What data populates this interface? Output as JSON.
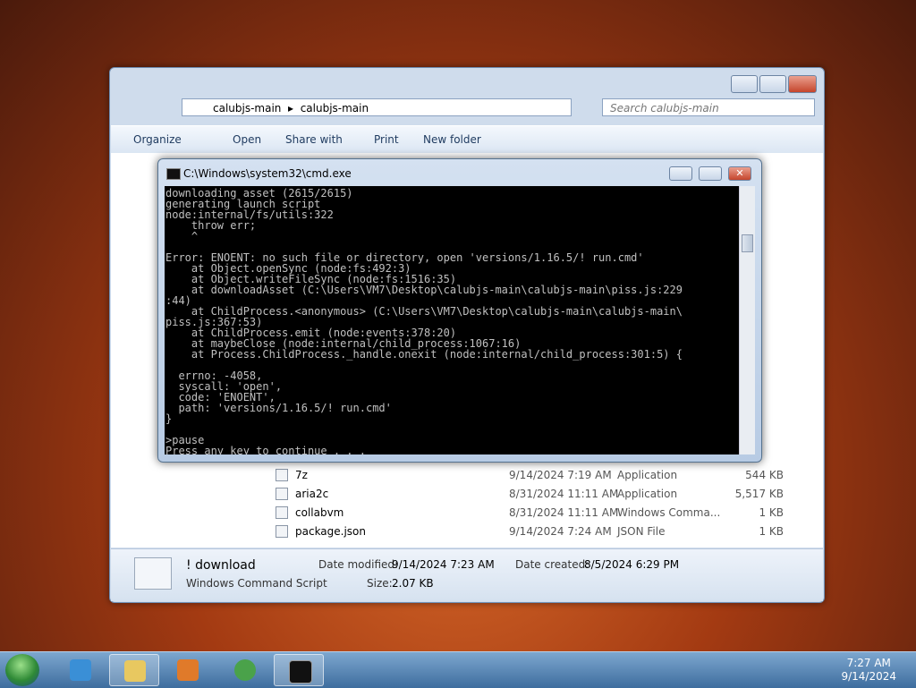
{
  "explorer": {
    "breadcrumb": [
      "calubjs-main",
      "calubjs-main"
    ],
    "search_placeholder": "Search calubjs-main",
    "toolbar": [
      "Organize",
      "Open",
      "Share with",
      "Print",
      "New folder"
    ],
    "files": [
      {
        "name": "7z",
        "date": "9/14/2024 7:19 AM",
        "type": "Application",
        "size": "544 KB"
      },
      {
        "name": "aria2c",
        "date": "8/31/2024 11:11 AM",
        "type": "Application",
        "size": "5,517 KB"
      },
      {
        "name": "collabvm",
        "date": "8/31/2024 11:11 AM",
        "type": "Windows Comma...",
        "size": "1 KB"
      },
      {
        "name": "package.json",
        "date": "9/14/2024 7:24 AM",
        "type": "JSON File",
        "size": "1 KB"
      }
    ],
    "details": {
      "name": "! download",
      "type": "Windows Command Script",
      "modified_label": "Date modified:",
      "modified": "9/14/2024 7:23 AM",
      "created_label": "Date created:",
      "created": "8/5/2024 6:29 PM",
      "size_label": "Size:",
      "size": "2.07 KB"
    }
  },
  "cmd": {
    "title": "C:\\Windows\\system32\\cmd.exe",
    "output": "downloading asset (2615/2615)\ngenerating launch script\nnode:internal/fs/utils:322\n    throw err;\n    ^\n\nError: ENOENT: no such file or directory, open 'versions/1.16.5/! run.cmd'\n    at Object.openSync (node:fs:492:3)\n    at Object.writeFileSync (node:fs:1516:35)\n    at downloadAsset (C:\\Users\\VM7\\Desktop\\calubjs-main\\calubjs-main\\piss.js:229\n:44)\n    at ChildProcess.<anonymous> (C:\\Users\\VM7\\Desktop\\calubjs-main\\calubjs-main\\\npiss.js:367:53)\n    at ChildProcess.emit (node:events:378:20)\n    at maybeClose (node:internal/child_process:1067:16)\n    at Process.ChildProcess._handle.onexit (node:internal/child_process:301:5) {\n\n  errno: -4058,\n  syscall: 'open',\n  code: 'ENOENT',\n  path: 'versions/1.16.5/! run.cmd'\n}\n\n>pause\nPress any key to continue . . ."
  },
  "clock": {
    "time": "7:27 AM",
    "date": "9/14/2024"
  }
}
